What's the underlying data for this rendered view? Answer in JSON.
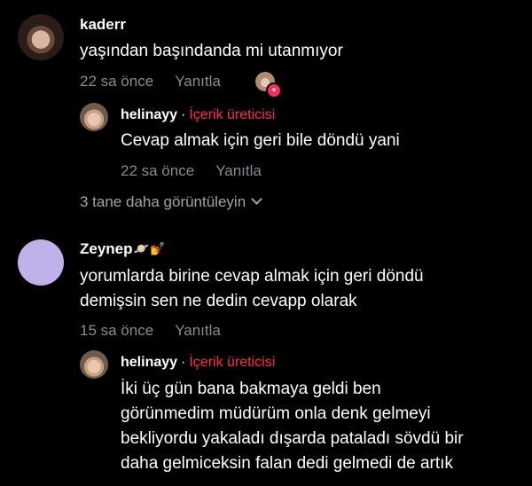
{
  "comments": [
    {
      "username": "kaderr",
      "text": "yaşından başındanda mi utanmıyor",
      "time": "22 sa önce",
      "reply_label": "Yanıtla",
      "replies": [
        {
          "username": "helinayy",
          "separator": "·",
          "badge": "İçerik üreticisi",
          "text": "Cevap almak için geri bile döndü yani",
          "time": "22 sa önce",
          "reply_label": "Yanıtla"
        }
      ],
      "view_more": "3 tane daha görüntüleyin"
    },
    {
      "username": "Zeynep",
      "username_emoji": [
        "🪐",
        "💅"
      ],
      "text_lines": [
        "yorumlarda birine cevap almak için geri döndü",
        "demişsin sen ne dedin cevapp olarak"
      ],
      "time": "15 sa önce",
      "reply_label": "Yanıtla",
      "replies": [
        {
          "username": "helinayy",
          "separator": "·",
          "badge": "İçerik üreticisi",
          "text_lines": [
            "İki üç gün bana bakmaya geldi ben",
            "görünmedim müdürüm onla denk gelmeyi",
            "bekliyordu yakaladı dışarda pataladı sövdü bir",
            "daha gelmiceksin falan dedi gelmedi de artık"
          ]
        }
      ]
    }
  ],
  "colors": {
    "background": "#000000",
    "text": "#ffffff",
    "muted": "#8a8b91",
    "creator_badge": "#fe2c55",
    "zeynep_avatar": "#c1b1ea"
  },
  "icons": {
    "author_like": "heart-icon",
    "expand": "chevron-down-icon"
  }
}
